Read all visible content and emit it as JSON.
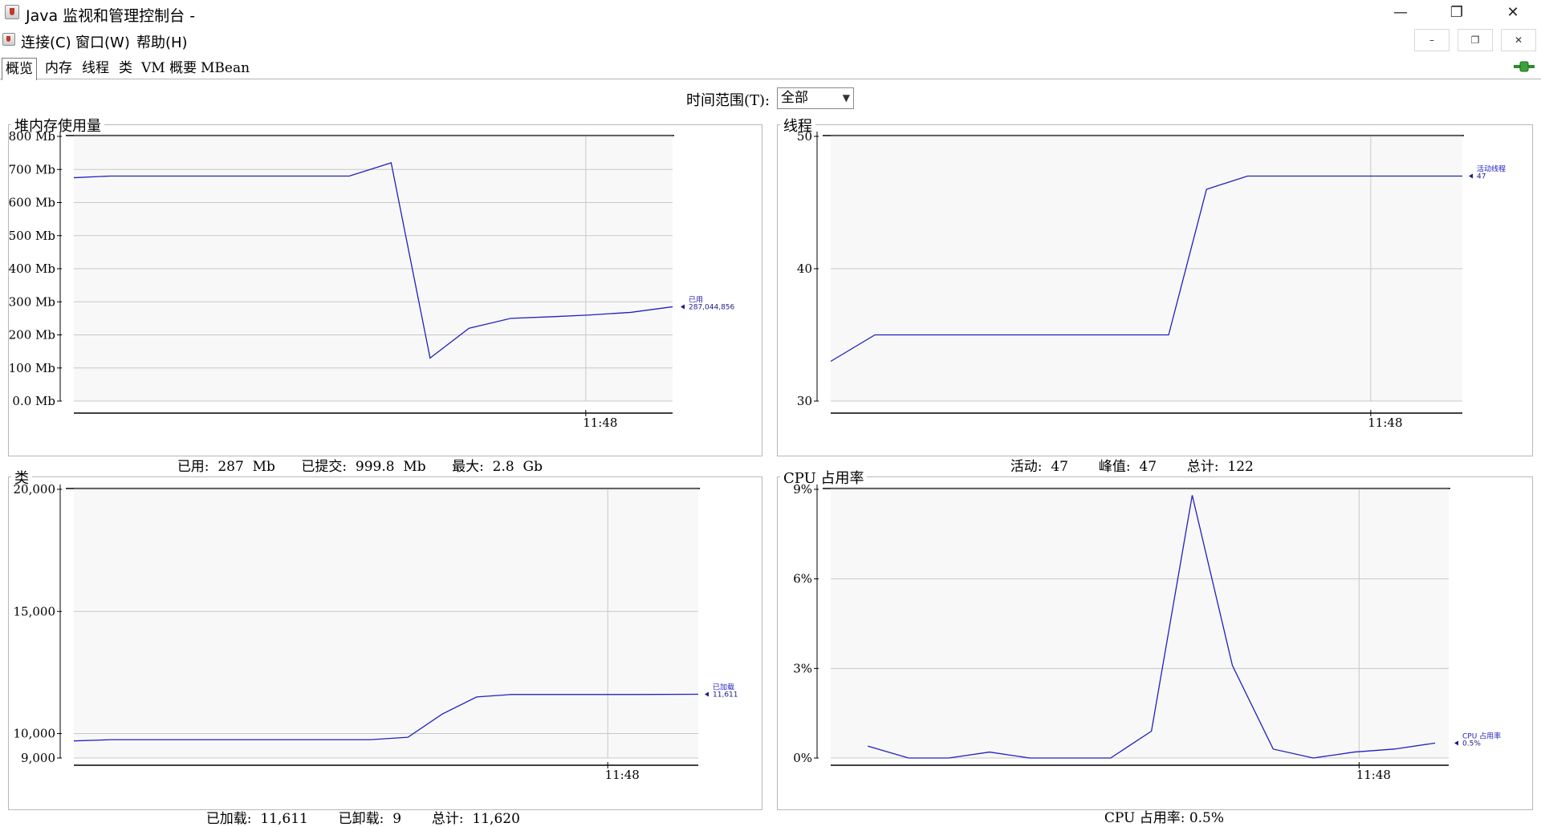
{
  "window": {
    "title": "Java 监视和管理控制台 -",
    "minimize_glyph": "—",
    "restore_glyph": "❐",
    "close_glyph": "✕"
  },
  "menu": {
    "items": [
      "连接(C)",
      "窗口(W)",
      "帮助(H)"
    ],
    "mdi_buttons": [
      "–",
      "❐",
      "✕"
    ]
  },
  "tabs": [
    "概览",
    "内存",
    "线程",
    "类",
    "VM 概要",
    "MBean"
  ],
  "active_tab": "概览",
  "time_range": {
    "label": "时间范围(T):",
    "value": "全部"
  },
  "panels": {
    "heap": {
      "title": "堆内存使用量",
      "legend_name": "已用",
      "legend_value": "287,044,856",
      "summary": [
        {
          "label": "已用:",
          "value": "287",
          "unit": "Mb"
        },
        {
          "label": "已提交:",
          "value": "999.8",
          "unit": "Mb"
        },
        {
          "label": "最大:",
          "value": "2.8",
          "unit": "Gb"
        }
      ]
    },
    "threads": {
      "title": "线程",
      "legend_name": "活动线程",
      "legend_value": "47",
      "summary": [
        {
          "label": "活动:",
          "value": "47",
          "unit": ""
        },
        {
          "label": "峰值:",
          "value": "47",
          "unit": ""
        },
        {
          "label": "总计:",
          "value": "122",
          "unit": ""
        }
      ]
    },
    "classes": {
      "title": "类",
      "legend_name": "已加载",
      "legend_value": "11,611",
      "summary": [
        {
          "label": "已加载:",
          "value": "11,611",
          "unit": ""
        },
        {
          "label": "已卸载:",
          "value": "9",
          "unit": ""
        },
        {
          "label": "总计:",
          "value": "11,620",
          "unit": ""
        }
      ]
    },
    "cpu": {
      "title": "CPU 占用率",
      "legend_name": "CPU 占用率",
      "legend_value": "0.5%",
      "summary": [
        {
          "label": "CPU 占用率:",
          "value": "0.5%",
          "unit": ""
        }
      ]
    }
  },
  "chart_data": [
    {
      "type": "line",
      "title": "堆内存使用量",
      "ylabel": "Mb",
      "ylim": [
        0,
        800
      ],
      "yticks": [
        "0.0 Mb",
        "100 Mb",
        "200 Mb",
        "300 Mb",
        "400 Mb",
        "500 Mb",
        "600 Mb",
        "700 Mb",
        "800 Mb"
      ],
      "ytick_values": [
        0,
        100,
        200,
        300,
        400,
        500,
        600,
        700,
        800
      ],
      "xticks": [
        "11:48"
      ],
      "xtick_pos": [
        0.855
      ],
      "series": [
        {
          "name": "已用",
          "x": [
            0,
            0.06,
            0.46,
            0.53,
            0.595,
            0.66,
            0.73,
            0.8,
            0.86,
            0.93,
            1.0
          ],
          "y": [
            675,
            680,
            680,
            720,
            130,
            220,
            250,
            255,
            260,
            268,
            285
          ]
        }
      ],
      "color": "#2020c0"
    },
    {
      "type": "line",
      "title": "线程",
      "ylim": [
        30,
        50
      ],
      "yticks": [
        "30",
        "40",
        "50"
      ],
      "ytick_values": [
        30,
        40,
        50
      ],
      "xticks": [
        "11:48"
      ],
      "xtick_pos": [
        0.855
      ],
      "series": [
        {
          "name": "活动线程",
          "x": [
            0,
            0.07,
            0.535,
            0.595,
            0.66,
            1.0
          ],
          "y": [
            33,
            35,
            35,
            46,
            47,
            47
          ]
        }
      ],
      "color": "#2020c0"
    },
    {
      "type": "line",
      "title": "类",
      "ylim": [
        9000,
        20000
      ],
      "yticks": [
        "9,000",
        "10,000",
        "15,000",
        "20,000"
      ],
      "ytick_values": [
        9000,
        10000,
        15000,
        20000
      ],
      "xticks": [
        "11:48"
      ],
      "xtick_pos": [
        0.855
      ],
      "series": [
        {
          "name": "已加载",
          "x": [
            0,
            0.06,
            0.475,
            0.535,
            0.59,
            0.645,
            0.7,
            0.8,
            0.9,
            1.0
          ],
          "y": [
            9700,
            9750,
            9750,
            9850,
            10800,
            11500,
            11600,
            11600,
            11600,
            11611
          ]
        }
      ],
      "color": "#2020c0"
    },
    {
      "type": "line",
      "title": "CPU 占用率",
      "ylim": [
        0,
        9
      ],
      "yticks": [
        "0%",
        "3%",
        "6%",
        "9%"
      ],
      "ytick_values": [
        0,
        3,
        6,
        9
      ],
      "xticks": [
        "11:48"
      ],
      "xtick_pos": [
        0.855
      ],
      "series": [
        {
          "name": "CPU 占用率",
          "x": [
            0.06,
            0.126,
            0.191,
            0.257,
            0.322,
            0.388,
            0.453,
            0.519,
            0.585,
            0.65,
            0.716,
            0.781,
            0.847,
            0.912,
            0.978
          ],
          "y": [
            0.4,
            0.0,
            0.0,
            0.2,
            0.0,
            0.0,
            0.0,
            0.9,
            8.8,
            3.1,
            0.3,
            0.0,
            0.2,
            0.3,
            0.5
          ]
        }
      ],
      "color": "#2020c0"
    }
  ]
}
